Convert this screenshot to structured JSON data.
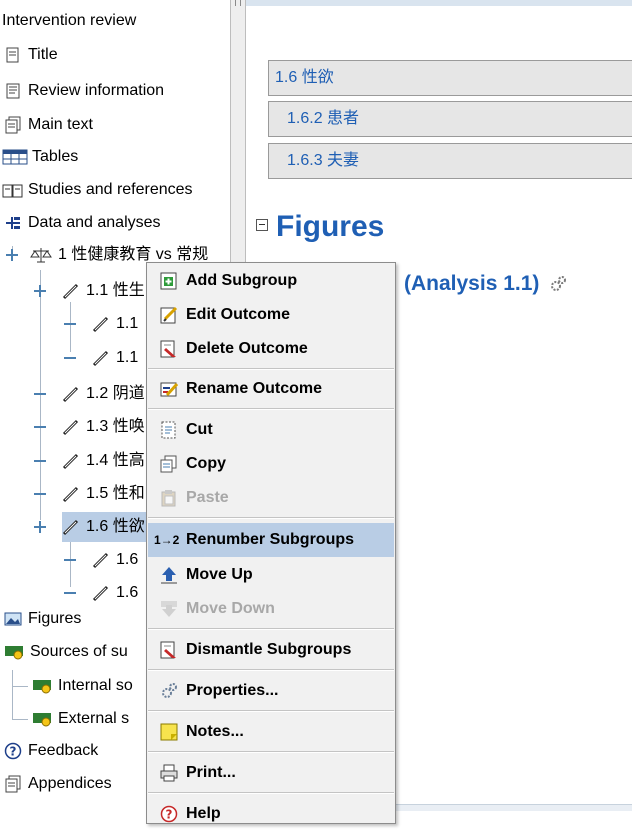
{
  "tree": {
    "items": [
      {
        "label": "Intervention review"
      },
      {
        "label": "Title"
      },
      {
        "label": "Review information"
      },
      {
        "label": "Main text"
      },
      {
        "label": "Tables"
      },
      {
        "label": "Studies and references"
      },
      {
        "label": "Data and analyses"
      },
      {
        "label": "1 性健康教育 vs 常规"
      },
      {
        "label": "1.1 性生"
      },
      {
        "label": "1.1"
      },
      {
        "label": "1.1"
      },
      {
        "label": "1.2 阴道"
      },
      {
        "label": "1.3 性唤"
      },
      {
        "label": "1.4 性高"
      },
      {
        "label": "1.5 性和"
      },
      {
        "label": "1.6 性欲"
      },
      {
        "label": "1.6"
      },
      {
        "label": "1.6"
      },
      {
        "label": "Figures"
      },
      {
        "label": "Sources of su"
      },
      {
        "label": "Internal so"
      },
      {
        "label": "External s"
      },
      {
        "label": "Feedback"
      },
      {
        "label": "Appendices"
      }
    ]
  },
  "doc": {
    "toc": [
      "1.6 性欲",
      "1.6.2 患者",
      "1.6.3 夫妻"
    ],
    "figures_heading": "Figures",
    "analysis_link": "(Analysis 1.1)"
  },
  "menu": {
    "items": [
      {
        "label": "Add Subgroup",
        "icon": "add-subgroup-icon"
      },
      {
        "label": "Edit Outcome",
        "icon": "edit-icon"
      },
      {
        "label": "Delete Outcome",
        "icon": "delete-icon"
      },
      {
        "label": "Rename Outcome",
        "icon": "rename-icon"
      },
      {
        "label": "Cut",
        "icon": "cut-icon"
      },
      {
        "label": "Copy",
        "icon": "copy-icon"
      },
      {
        "label": "Paste",
        "icon": "paste-icon",
        "disabled": true
      },
      {
        "label": "Renumber Subgroups",
        "icon": "renumber-icon",
        "selected": true,
        "glyph": "1→2"
      },
      {
        "label": "Move Up",
        "icon": "move-up-icon"
      },
      {
        "label": "Move Down",
        "icon": "move-down-icon",
        "disabled": true
      },
      {
        "label": "Dismantle Subgroups",
        "icon": "dismantle-icon"
      },
      {
        "label": "Properties...",
        "icon": "properties-icon"
      },
      {
        "label": "Notes...",
        "icon": "notes-icon"
      },
      {
        "label": "Print...",
        "icon": "print-icon"
      },
      {
        "label": "Help",
        "icon": "help-icon"
      }
    ]
  },
  "colors": {
    "link": "#1f5fb4",
    "selection": "#b9cde5",
    "menu_bg": "#f1f1f1",
    "toc_bg": "#e6e6e6"
  }
}
